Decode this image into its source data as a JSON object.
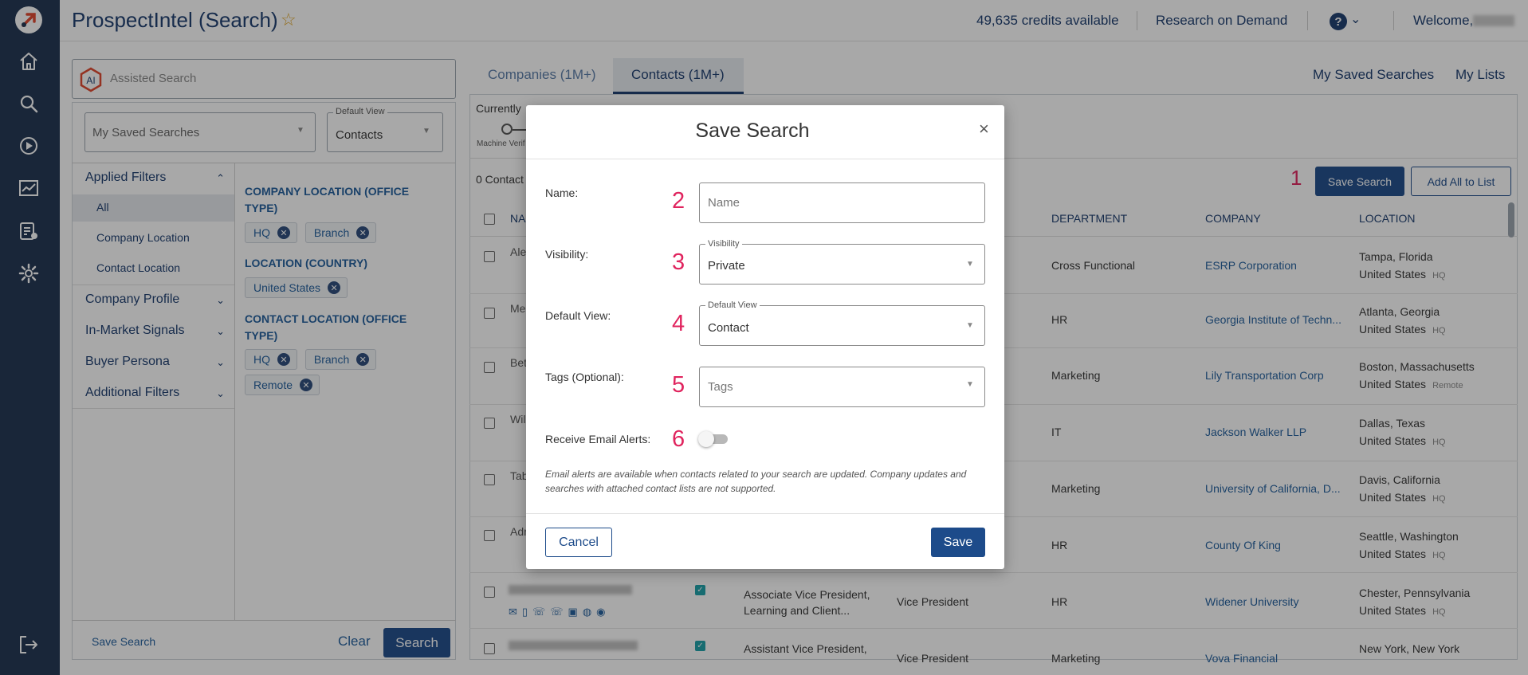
{
  "header": {
    "app_title": "ProspectIntel (Search)",
    "credits": "49,635 credits available",
    "research_on_demand": "Research on Demand",
    "help": "?",
    "welcome": "Welcome,"
  },
  "nav_icons": [
    "logo-icon",
    "home-icon",
    "search-icon",
    "play-icon",
    "analytics-icon",
    "reports-icon",
    "settings-icon",
    "logout-icon"
  ],
  "left_panel": {
    "assisted_search_placeholder": "Assisted Search",
    "assisted_icon_text": "AI",
    "my_saved_searches": "My Saved Searches",
    "default_view_label": "Default View",
    "default_view_value": "Contacts",
    "sidebar": {
      "applied_filters": "Applied Filters",
      "all": "All",
      "company_location": "Company Location",
      "contact_location": "Contact Location",
      "company_profile": "Company Profile",
      "in_market_signals": "In-Market Signals",
      "buyer_persona": "Buyer Persona",
      "additional_filters": "Additional Filters"
    },
    "filters": {
      "company_location_heading": "COMPANY LOCATION (OFFICE TYPE)",
      "company_location_chips": [
        "HQ",
        "Branch"
      ],
      "location_country_heading": "LOCATION (COUNTRY)",
      "location_country_chips": [
        "United States"
      ],
      "contact_location_heading": "CONTACT LOCATION (OFFICE TYPE)",
      "contact_location_chips": [
        "HQ",
        "Branch",
        "Remote"
      ]
    },
    "save_search_link": "Save Search",
    "clear": "Clear",
    "search": "Search"
  },
  "results": {
    "tabs": [
      "Companies (1M+)",
      "Contacts (1M+)"
    ],
    "my_saved_searches": "My Saved Searches",
    "my_lists": "My Lists",
    "currently": "Currently",
    "machine_verified": "Machine Verif",
    "results_count": "0 Contact",
    "marker": "1",
    "save_search": "Save Search",
    "add_all_to_list": "Add All to List",
    "columns": {
      "name": "NA",
      "department": "DEPARTMENT",
      "company": "COMPANY",
      "location": "LOCATION"
    },
    "rows": [
      {
        "name_frag": "Ale",
        "department": "Cross Functional",
        "company": "ESRP Corporation",
        "city": "Tampa, Florida",
        "country": "United States",
        "tag": "HQ"
      },
      {
        "name_frag": "Me",
        "department": "HR",
        "company": "Georgia Institute of Techn...",
        "city": "Atlanta, Georgia",
        "country": "United States",
        "tag": "HQ"
      },
      {
        "name_frag": "Bet",
        "department": "Marketing",
        "company": "Lily Transportation Corp",
        "city": "Boston, Massachusetts",
        "country": "United States",
        "tag": "Remote"
      },
      {
        "name_frag": "Wil",
        "department": "IT",
        "company": "Jackson Walker LLP",
        "city": "Dallas, Texas",
        "country": "United States",
        "tag": "HQ"
      },
      {
        "name_frag": "Tab",
        "department": "Marketing",
        "company": "University of California, D...",
        "city": "Davis, California",
        "country": "United States",
        "tag": "HQ"
      },
      {
        "name_frag": "Adr",
        "department": "HR",
        "company": "County Of King",
        "city": "Seattle, Washington",
        "country": "United States",
        "tag": "HQ"
      },
      {
        "name_frag": "",
        "title": "Associate Vice President, Learning and Client...",
        "level": "Vice President",
        "department": "HR",
        "company": "Widener University",
        "city": "Chester, Pennsylvania",
        "country": "United States",
        "tag": "HQ"
      },
      {
        "name_frag": "",
        "title": "Assistant Vice President,",
        "level": "Vice President",
        "department": "Marketing",
        "company": "Vova Financial",
        "city": "New York, New York",
        "country": "",
        "tag": ""
      }
    ]
  },
  "modal": {
    "title": "Save Search",
    "close": "×",
    "name_label": "Name:",
    "name_num": "2",
    "name_placeholder": "Name",
    "visibility_label": "Visibility:",
    "visibility_num": "3",
    "visibility_field_label": "Visibility",
    "visibility_value": "Private",
    "default_view_label": "Default View:",
    "default_view_num": "4",
    "default_view_field_label": "Default View",
    "default_view_value": "Contact",
    "tags_label": "Tags (Optional):",
    "tags_num": "5",
    "tags_placeholder": "Tags",
    "alerts_label": "Receive Email Alerts:",
    "alerts_num": "6",
    "alerts_on": false,
    "note": "Email alerts are available when contacts related to your search are updated. Company updates and searches with attached contact lists are not supported.",
    "cancel": "Cancel",
    "save": "Save"
  },
  "colors": {
    "nav_bg": "#1d3150",
    "primary": "#1d4b8a",
    "marker": "#e0245e",
    "link": "#1f5d9c"
  }
}
